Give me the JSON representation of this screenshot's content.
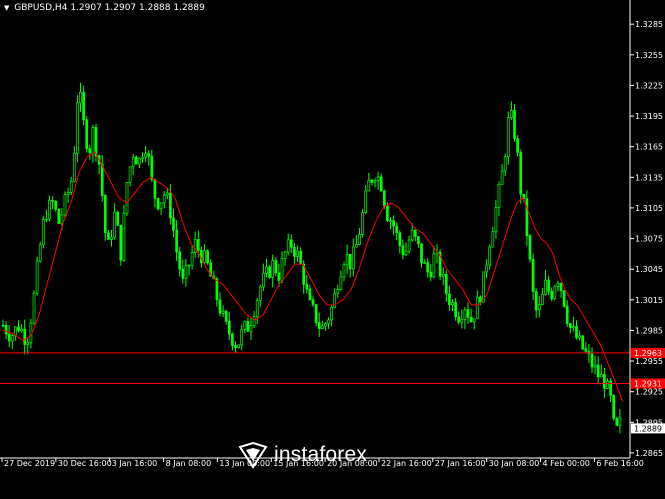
{
  "header": {
    "symbol": "GBPUSD,H4",
    "quote": "1.2907 1.2907 1.2888 1.2889"
  },
  "watermark": {
    "brand": "instaforex"
  },
  "colors": {
    "background": "#000000",
    "candle": "#00ff00",
    "moving_average": "#ff0000",
    "level_line": "#ff0000",
    "axis": "#ffffff"
  },
  "chart_data": {
    "type": "candlestick",
    "y_axis_ticks": [
      "1.3285",
      "1.3255",
      "1.3225",
      "1.3195",
      "1.3165",
      "1.3135",
      "1.3105",
      "1.3075",
      "1.3045",
      "1.3015",
      "1.2985",
      "1.2955",
      "1.2925",
      "1.2895",
      "1.2865"
    ],
    "ylim": [
      1.286,
      1.3295
    ],
    "x_axis_labels": [
      "27 Dec 2019",
      "30 Dec 16:00",
      "3 Jan 16:00",
      "8 Jan 08:00",
      "13 Jan 00:00",
      "15 Jan 16:00",
      "20 Jan 08:00",
      "22 Jan 16:00",
      "27 Jan 16:00",
      "30 Jan 08:00",
      "4 Feb 00:00",
      "6 Feb 16:00"
    ],
    "levels": [
      {
        "value": 1.2963,
        "label": "1.2963"
      },
      {
        "value": 1.2933,
        "label": "1.2931"
      }
    ],
    "last_price": {
      "value": 1.2889,
      "label": "1.2889"
    },
    "price_path": [
      [
        0,
        1.299
      ],
      [
        8,
        1.298
      ],
      [
        16,
        1.299
      ],
      [
        24,
        1.2975
      ],
      [
        30,
        1.301
      ],
      [
        36,
        1.306
      ],
      [
        42,
        1.31
      ],
      [
        50,
        1.311
      ],
      [
        56,
        1.309
      ],
      [
        62,
        1.311
      ],
      [
        68,
        1.313
      ],
      [
        72,
        1.317
      ],
      [
        76,
        1.324
      ],
      [
        78,
        1.32
      ],
      [
        82,
        1.318
      ],
      [
        86,
        1.316
      ],
      [
        90,
        1.318
      ],
      [
        96,
        1.315
      ],
      [
        100,
        1.311
      ],
      [
        104,
        1.306
      ],
      [
        108,
        1.308
      ],
      [
        112,
        1.31
      ],
      [
        118,
        1.306
      ],
      [
        124,
        1.313
      ],
      [
        130,
        1.316
      ],
      [
        136,
        1.315
      ],
      [
        142,
        1.317
      ],
      [
        146,
        1.315
      ],
      [
        150,
        1.312
      ],
      [
        156,
        1.311
      ],
      [
        162,
        1.312
      ],
      [
        168,
        1.31
      ],
      [
        174,
        1.306
      ],
      [
        180,
        1.303
      ],
      [
        186,
        1.305
      ],
      [
        192,
        1.307
      ],
      [
        198,
        1.306
      ],
      [
        204,
        1.305
      ],
      [
        210,
        1.303
      ],
      [
        216,
        1.301
      ],
      [
        222,
        1.299
      ],
      [
        228,
        1.298
      ],
      [
        234,
        1.297
      ],
      [
        240,
        1.2985
      ],
      [
        246,
        1.299
      ],
      [
        252,
        1.301
      ],
      [
        258,
        1.303
      ],
      [
        264,
        1.304
      ],
      [
        270,
        1.305
      ],
      [
        276,
        1.304
      ],
      [
        282,
        1.306
      ],
      [
        288,
        1.307
      ],
      [
        294,
        1.306
      ],
      [
        300,
        1.304
      ],
      [
        306,
        1.301
      ],
      [
        312,
        1.3
      ],
      [
        318,
        1.2985
      ],
      [
        324,
        1.2995
      ],
      [
        330,
        1.301
      ],
      [
        336,
        1.304
      ],
      [
        342,
        1.306
      ],
      [
        348,
        1.305
      ],
      [
        354,
        1.307
      ],
      [
        360,
        1.31
      ],
      [
        366,
        1.313
      ],
      [
        372,
        1.314
      ],
      [
        378,
        1.313
      ],
      [
        384,
        1.31
      ],
      [
        390,
        1.309
      ],
      [
        396,
        1.307
      ],
      [
        402,
        1.306
      ],
      [
        408,
        1.308
      ],
      [
        414,
        1.307
      ],
      [
        420,
        1.305
      ],
      [
        426,
        1.304
      ],
      [
        432,
        1.306
      ],
      [
        438,
        1.304
      ],
      [
        444,
        1.302
      ],
      [
        450,
        1.301
      ],
      [
        456,
        1.3
      ],
      [
        462,
        1.301
      ],
      [
        468,
        1.2995
      ],
      [
        474,
        1.301
      ],
      [
        480,
        1.303
      ],
      [
        486,
        1.307
      ],
      [
        492,
        1.31
      ],
      [
        498,
        1.313
      ],
      [
        502,
        1.316
      ],
      [
        506,
        1.3195
      ],
      [
        510,
        1.319
      ],
      [
        514,
        1.316
      ],
      [
        518,
        1.312
      ],
      [
        522,
        1.31
      ],
      [
        526,
        1.306
      ],
      [
        530,
        1.302
      ],
      [
        534,
        1.3
      ],
      [
        538,
        1.301
      ],
      [
        542,
        1.303
      ],
      [
        548,
        1.302
      ],
      [
        554,
        1.304
      ],
      [
        560,
        1.302
      ],
      [
        566,
        1.299
      ],
      [
        572,
        1.298
      ],
      [
        578,
        1.297
      ],
      [
        584,
        1.296
      ],
      [
        590,
        1.295
      ],
      [
        596,
        1.294
      ],
      [
        602,
        1.2935
      ],
      [
        608,
        1.2915
      ],
      [
        612,
        1.288
      ],
      [
        616,
        1.2895
      ],
      [
        620,
        1.2889
      ]
    ],
    "ma_path": [
      [
        0,
        1.2985
      ],
      [
        10,
        1.2982
      ],
      [
        20,
        1.2975
      ],
      [
        28,
        1.298
      ],
      [
        36,
        1.3
      ],
      [
        44,
        1.303
      ],
      [
        52,
        1.306
      ],
      [
        60,
        1.309
      ],
      [
        68,
        1.311
      ],
      [
        76,
        1.314
      ],
      [
        84,
        1.3155
      ],
      [
        92,
        1.316
      ],
      [
        100,
        1.3145
      ],
      [
        108,
        1.313
      ],
      [
        116,
        1.3115
      ],
      [
        124,
        1.311
      ],
      [
        132,
        1.312
      ],
      [
        140,
        1.313
      ],
      [
        148,
        1.3135
      ],
      [
        156,
        1.313
      ],
      [
        164,
        1.3125
      ],
      [
        172,
        1.3115
      ],
      [
        180,
        1.309
      ],
      [
        188,
        1.307
      ],
      [
        196,
        1.306
      ],
      [
        204,
        1.3045
      ],
      [
        212,
        1.3035
      ],
      [
        220,
        1.303
      ],
      [
        228,
        1.302
      ],
      [
        236,
        1.301
      ],
      [
        244,
        1.3
      ],
      [
        252,
        1.2995
      ],
      [
        260,
        1.3
      ],
      [
        268,
        1.3015
      ],
      [
        276,
        1.303
      ],
      [
        284,
        1.304
      ],
      [
        292,
        1.305
      ],
      [
        300,
        1.305
      ],
      [
        308,
        1.3035
      ],
      [
        316,
        1.302
      ],
      [
        324,
        1.301
      ],
      [
        332,
        1.301
      ],
      [
        340,
        1.3015
      ],
      [
        348,
        1.3025
      ],
      [
        356,
        1.3045
      ],
      [
        364,
        1.307
      ],
      [
        372,
        1.309
      ],
      [
        380,
        1.3105
      ],
      [
        388,
        1.311
      ],
      [
        396,
        1.3105
      ],
      [
        404,
        1.3095
      ],
      [
        412,
        1.3085
      ],
      [
        420,
        1.308
      ],
      [
        428,
        1.307
      ],
      [
        436,
        1.306
      ],
      [
        444,
        1.3045
      ],
      [
        452,
        1.3035
      ],
      [
        460,
        1.3025
      ],
      [
        468,
        1.301
      ],
      [
        476,
        1.301
      ],
      [
        484,
        1.302
      ],
      [
        492,
        1.3045
      ],
      [
        500,
        1.307
      ],
      [
        508,
        1.3095
      ],
      [
        514,
        1.311
      ],
      [
        520,
        1.3115
      ],
      [
        526,
        1.31
      ],
      [
        532,
        1.3085
      ],
      [
        538,
        1.3075
      ],
      [
        544,
        1.307
      ],
      [
        550,
        1.306
      ],
      [
        556,
        1.304
      ],
      [
        562,
        1.3025
      ],
      [
        568,
        1.3015
      ],
      [
        574,
        1.301
      ],
      [
        580,
        1.3
      ],
      [
        586,
        1.299
      ],
      [
        592,
        1.298
      ],
      [
        598,
        1.297
      ],
      [
        604,
        1.2955
      ],
      [
        610,
        1.294
      ],
      [
        616,
        1.2925
      ],
      [
        620,
        1.2915
      ]
    ]
  }
}
